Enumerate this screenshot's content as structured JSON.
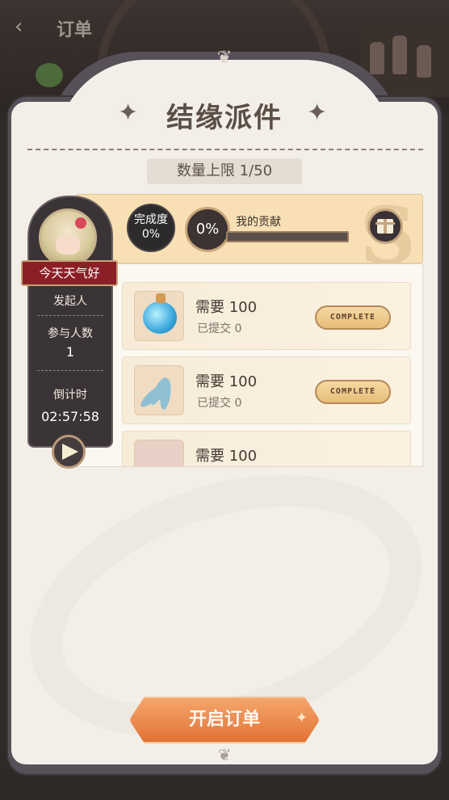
{
  "topbar": {
    "back_icon": "chevron-left-icon",
    "title": "订单"
  },
  "panel": {
    "title": "结缘派件",
    "limit_text": "数量上限 1/50",
    "ornament": "❦"
  },
  "progress": {
    "completion_label": "完成度",
    "completion_value": "0%",
    "my_contribution_value": "0%",
    "my_contribution_label": "我的贡献",
    "my_contribution_fraction": 0,
    "gift_icon": "gift-icon"
  },
  "profile": {
    "player_name": "今天天气好",
    "initiator_label": "发起人",
    "participants_label": "参与人数",
    "participants_value": "1",
    "countdown_label": "倒计时",
    "countdown_value": "02:57:58"
  },
  "items": [
    {
      "need": "需要 100",
      "submitted": "已提交 0",
      "button": "COMPLETE",
      "icon": "potion-icon"
    },
    {
      "need": "需要 100",
      "submitted": "已提交 0",
      "button": "COMPLETE",
      "icon": "feather-icon"
    },
    {
      "need": "需要 100",
      "icon": "flower-icon"
    }
  ],
  "actions": {
    "open_order": "开启订单"
  },
  "colors": {
    "accent_orange": "#e27236",
    "banner": "#f8e0b4",
    "dark_panel": "#3a3436",
    "ribbon_red": "#8c1f26"
  }
}
